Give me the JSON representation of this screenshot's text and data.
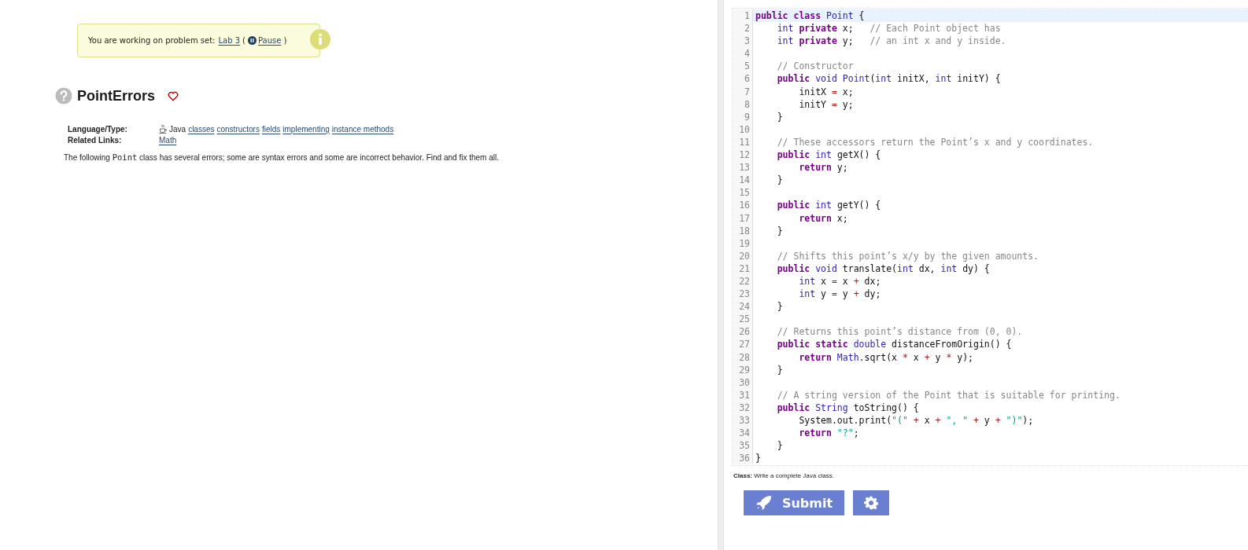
{
  "notice": {
    "text": "You are working on problem set:",
    "set_link": "Lab 3",
    "pause_link": "Pause",
    "open_paren": "(",
    "close_paren": ")"
  },
  "problem": {
    "title": "PointErrors",
    "favorite": false,
    "meta": [
      {
        "label": "Language/Type:",
        "kind": "tags",
        "language": "Java",
        "links": [
          "classes",
          "constructors",
          "fields",
          "implementing",
          "instance methods"
        ]
      },
      {
        "label": "Related Links:",
        "kind": "links",
        "links": [
          "Math"
        ]
      }
    ],
    "description": {
      "before": "The following",
      "code": "Point",
      "after": "class has several errors; some are syntax errors and some are incorrect behavior. Find and fix them all."
    }
  },
  "editor": {
    "lines": [
      {
        "n": "1",
        "active": true,
        "tokens": [
          {
            "text": "public",
            "kind": "kw"
          },
          {
            "text": " class",
            "kind": "kw"
          },
          {
            "text": " Point",
            "kind": "type"
          },
          {
            "text": " {",
            "kind": "plain"
          }
        ]
      },
      {
        "n": "2",
        "active": false,
        "tokens": [
          {
            "text": "    int",
            "kind": "type"
          },
          {
            "text": " private",
            "kind": "kw"
          },
          {
            "text": " x;",
            "kind": "plain"
          },
          {
            "text": "   // Each Point object has",
            "kind": "comment"
          }
        ]
      },
      {
        "n": "3",
        "active": false,
        "tokens": [
          {
            "text": "    int",
            "kind": "type"
          },
          {
            "text": " private",
            "kind": "kw"
          },
          {
            "text": " y;",
            "kind": "plain"
          },
          {
            "text": "   // an int x and y inside.",
            "kind": "comment"
          }
        ]
      },
      {
        "n": "4",
        "active": false
      },
      {
        "n": "5",
        "active": false,
        "tokens": [
          {
            "text": "    // Constructor",
            "kind": "comment"
          }
        ]
      },
      {
        "n": "6",
        "active": false,
        "tokens": [
          {
            "text": "    public",
            "kind": "kw"
          },
          {
            "text": " void",
            "kind": "type"
          },
          {
            "text": " Point",
            "kind": "type"
          },
          {
            "text": "(",
            "kind": "plain"
          },
          {
            "text": "int",
            "kind": "type"
          },
          {
            "text": " initX,",
            "kind": "plain"
          },
          {
            "text": " int",
            "kind": "type"
          },
          {
            "text": " initY) {",
            "kind": "plain"
          }
        ]
      },
      {
        "n": "7",
        "active": false,
        "tokens": [
          {
            "text": "        initX",
            "kind": "plain"
          },
          {
            "text": " =",
            "kind": "op"
          },
          {
            "text": " x;",
            "kind": "plain"
          }
        ]
      },
      {
        "n": "8",
        "active": false,
        "tokens": [
          {
            "text": "        initY",
            "kind": "plain"
          },
          {
            "text": " =",
            "kind": "op"
          },
          {
            "text": " y;",
            "kind": "plain"
          }
        ]
      },
      {
        "n": "9",
        "active": false,
        "tokens": [
          {
            "text": "    }",
            "kind": "plain"
          }
        ]
      },
      {
        "n": "10",
        "active": false
      },
      {
        "n": "11",
        "active": false,
        "tokens": [
          {
            "text": "    // These accessors return the Point’s x and y coordinates.",
            "kind": "comment"
          }
        ]
      },
      {
        "n": "12",
        "active": false,
        "tokens": [
          {
            "text": "    public",
            "kind": "kw"
          },
          {
            "text": " int",
            "kind": "type"
          },
          {
            "text": " getX() {",
            "kind": "plain"
          }
        ]
      },
      {
        "n": "13",
        "active": false,
        "tokens": [
          {
            "text": "        return",
            "kind": "kw"
          },
          {
            "text": " y;",
            "kind": "plain"
          }
        ]
      },
      {
        "n": "14",
        "active": false,
        "tokens": [
          {
            "text": "    }",
            "kind": "plain"
          }
        ]
      },
      {
        "n": "15",
        "active": false
      },
      {
        "n": "16",
        "active": false,
        "tokens": [
          {
            "text": "    public",
            "kind": "kw"
          },
          {
            "text": " int",
            "kind": "type"
          },
          {
            "text": " getY() {",
            "kind": "plain"
          }
        ]
      },
      {
        "n": "17",
        "active": false,
        "tokens": [
          {
            "text": "        return",
            "kind": "kw"
          },
          {
            "text": " x;",
            "kind": "plain"
          }
        ]
      },
      {
        "n": "18",
        "active": false,
        "tokens": [
          {
            "text": "    }",
            "kind": "plain"
          }
        ]
      },
      {
        "n": "19",
        "active": false
      },
      {
        "n": "20",
        "active": false,
        "tokens": [
          {
            "text": "    // Shifts this point’s x/y by the given amounts.",
            "kind": "comment"
          }
        ]
      },
      {
        "n": "21",
        "active": false,
        "tokens": [
          {
            "text": "    public",
            "kind": "kw"
          },
          {
            "text": " void",
            "kind": "type"
          },
          {
            "text": " translate(",
            "kind": "plain"
          },
          {
            "text": "int",
            "kind": "type"
          },
          {
            "text": " dx,",
            "kind": "plain"
          },
          {
            "text": " int",
            "kind": "type"
          },
          {
            "text": " dy) {",
            "kind": "plain"
          }
        ]
      },
      {
        "n": "22",
        "active": false,
        "tokens": [
          {
            "text": "        int",
            "kind": "type"
          },
          {
            "text": " x",
            "kind": "plain"
          },
          {
            "text": " =",
            "kind": "op"
          },
          {
            "text": " x",
            "kind": "plain"
          },
          {
            "text": " +",
            "kind": "op"
          },
          {
            "text": " dx;",
            "kind": "plain"
          }
        ]
      },
      {
        "n": "23",
        "active": false,
        "tokens": [
          {
            "text": "        int",
            "kind": "type"
          },
          {
            "text": " y",
            "kind": "plain"
          },
          {
            "text": " =",
            "kind": "op"
          },
          {
            "text": " y",
            "kind": "plain"
          },
          {
            "text": " +",
            "kind": "op"
          },
          {
            "text": " dy;",
            "kind": "plain"
          }
        ]
      },
      {
        "n": "24",
        "active": false,
        "tokens": [
          {
            "text": "    }",
            "kind": "plain"
          }
        ]
      },
      {
        "n": "25",
        "active": false
      },
      {
        "n": "26",
        "active": false,
        "tokens": [
          {
            "text": "    // Returns this point’s distance from (0, 0).",
            "kind": "comment"
          }
        ]
      },
      {
        "n": "27",
        "active": false,
        "tokens": [
          {
            "text": "    public",
            "kind": "kw"
          },
          {
            "text": " static",
            "kind": "kw"
          },
          {
            "text": " double",
            "kind": "type"
          },
          {
            "text": " distanceFromOrigin() {",
            "kind": "plain"
          }
        ]
      },
      {
        "n": "28",
        "active": false,
        "tokens": [
          {
            "text": "        return",
            "kind": "kw"
          },
          {
            "text": " Math",
            "kind": "type"
          },
          {
            "text": ".sqrt(x",
            "kind": "plain"
          },
          {
            "text": " *",
            "kind": "op"
          },
          {
            "text": " x",
            "kind": "plain"
          },
          {
            "text": " +",
            "kind": "op"
          },
          {
            "text": " y",
            "kind": "plain"
          },
          {
            "text": " *",
            "kind": "op"
          },
          {
            "text": " y);",
            "kind": "plain"
          }
        ]
      },
      {
        "n": "29",
        "active": false,
        "tokens": [
          {
            "text": "    }",
            "kind": "plain"
          }
        ]
      },
      {
        "n": "30",
        "active": false
      },
      {
        "n": "31",
        "active": false,
        "tokens": [
          {
            "text": "    // A string version of the Point that is suitable for printing.",
            "kind": "comment"
          }
        ]
      },
      {
        "n": "32",
        "active": false,
        "tokens": [
          {
            "text": "    public",
            "kind": "kw"
          },
          {
            "text": " String",
            "kind": "type"
          },
          {
            "text": " toString() {",
            "kind": "plain"
          }
        ]
      },
      {
        "n": "33",
        "active": false,
        "tokens": [
          {
            "text": "        System.out.print(",
            "kind": "plain"
          },
          {
            "text": "\"(\"",
            "kind": "string"
          },
          {
            "text": " +",
            "kind": "op"
          },
          {
            "text": " x",
            "kind": "plain"
          },
          {
            "text": " +",
            "kind": "op"
          },
          {
            "text": " \", \"",
            "kind": "string"
          },
          {
            "text": " +",
            "kind": "op"
          },
          {
            "text": " y",
            "kind": "plain"
          },
          {
            "text": " +",
            "kind": "op"
          },
          {
            "text": " \")\"",
            "kind": "string"
          },
          {
            "text": ");",
            "kind": "plain"
          }
        ]
      },
      {
        "n": "34",
        "active": false,
        "tokens": [
          {
            "text": "        return",
            "kind": "kw"
          },
          {
            "text": " \"?\"",
            "kind": "string"
          },
          {
            "text": ";",
            "kind": "plain"
          }
        ]
      },
      {
        "n": "35",
        "active": false,
        "tokens": [
          {
            "text": "    }",
            "kind": "plain"
          }
        ]
      },
      {
        "n": "36",
        "active": false,
        "tokens": [
          {
            "text": "}",
            "kind": "plain"
          }
        ]
      }
    ]
  },
  "hint": "**Class:** Write a complete Java class.",
  "submit_label": "Submit"
}
